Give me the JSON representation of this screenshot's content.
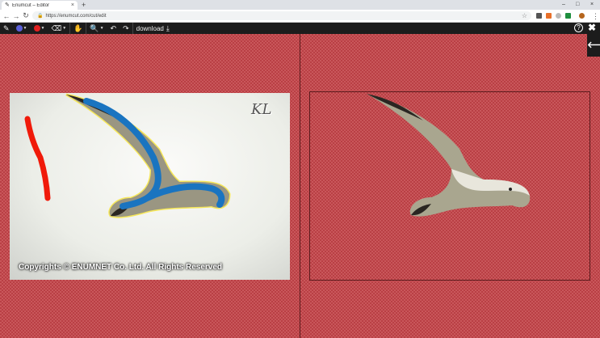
{
  "browser": {
    "tab_title": "Enumcut – Editor",
    "tab_close": "×",
    "new_tab": "+",
    "url": "https://enumcut.com/cut/edit",
    "window_controls": [
      "–",
      "□",
      "×"
    ]
  },
  "toolbar": {
    "download_label": "download",
    "help_label": "?",
    "close_label": "✖",
    "brush_color_keep": "#5a5fd8",
    "brush_color_remove": "#e02020"
  },
  "editor": {
    "source_copyright": "Copyrights © ENUMNET Co. Ltd. All Rights Reserved",
    "watermark": "KL",
    "sidebar_toggle": "🡐"
  },
  "colors": {
    "checker_light": "#c9575b",
    "checker_dark": "#b93f44",
    "toolbar_bg": "#1c1c1c",
    "keep_stroke": "#1a74c0",
    "remove_stroke": "#f01a0a"
  }
}
